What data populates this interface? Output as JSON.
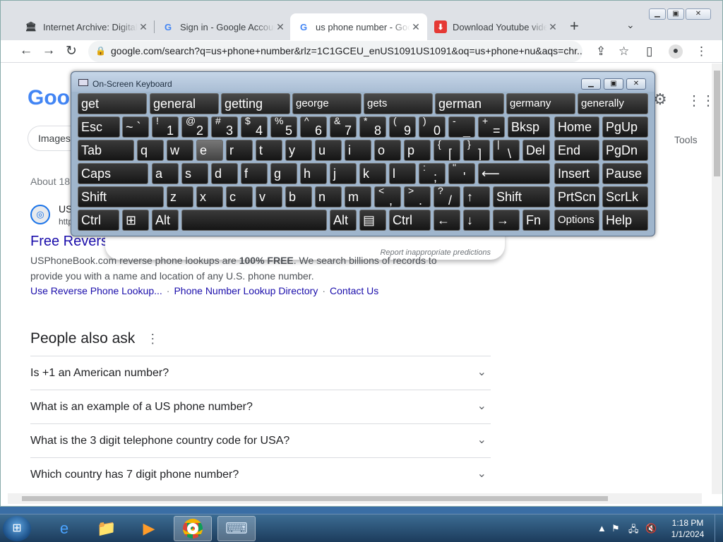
{
  "browser": {
    "tabs": [
      {
        "title": "Internet Archive: Digital",
        "icon": "museum-icon",
        "active": false
      },
      {
        "title": "Sign in - Google Accoun",
        "icon": "google-g-icon",
        "active": false
      },
      {
        "title": "us phone number - Goo",
        "icon": "google-g-icon",
        "active": true
      },
      {
        "title": "Download Youtube vide",
        "icon": "download-red-icon",
        "active": false
      }
    ],
    "new_tab": "+",
    "tab_close": "✕",
    "url": "google.com/search?q=us+phone+number&rlz=1C1GCEU_enUS1091US1091&oq=us+phone+nu&aqs=chr..."
  },
  "page": {
    "chip_images": "Images",
    "tools": "Tools",
    "about": "About 18,",
    "result": {
      "site_name": "US",
      "site_url": "http",
      "title": "Free Revers",
      "snippet_pre": "USPhoneBook.com reverse phone lookups are ",
      "snippet_bold1": "100% FREE",
      "snippet_mid": ". We search billions of records to provide you with a name and location of any U.S. phone number.",
      "links": [
        "Use Reverse Phone Lookup...",
        "Phone Number Lookup Directory",
        "Contact Us"
      ]
    },
    "report": "Report inappropriate predictions",
    "people_also_ask": "People also ask",
    "questions": [
      "Is +1 an American number?",
      "What is an example of a US phone number?",
      "What is the 3 digit telephone country code for USA?",
      "Which country has 7 digit phone number?"
    ]
  },
  "osk": {
    "title": "On-Screen Keyboard",
    "predictions": [
      "get",
      "general",
      "getting",
      "george",
      "gets",
      "german",
      "germany",
      "generally"
    ],
    "row1": {
      "esc": "Esc",
      "bksp": "Bksp",
      "home": "Home",
      "pgup": "PgUp"
    },
    "row2": {
      "tab": "Tab",
      "letters": [
        "q",
        "w",
        "e",
        "r",
        "t",
        "y",
        "u",
        "i",
        "o",
        "p"
      ],
      "del": "Del",
      "end": "End",
      "pgdn": "PgDn"
    },
    "row3": {
      "caps": "Caps",
      "letters": [
        "a",
        "s",
        "d",
        "f",
        "g",
        "h",
        "j",
        "k",
        "l"
      ],
      "insert": "Insert",
      "pause": "Pause"
    },
    "row4": {
      "shift": "Shift",
      "letters": [
        "z",
        "x",
        "c",
        "v",
        "b",
        "n",
        "m"
      ],
      "prtscn": "PrtScn",
      "scrlk": "ScrLk"
    },
    "row5": {
      "ctrl": "Ctrl",
      "alt": "Alt",
      "fn": "Fn",
      "options": "Options",
      "help": "Help"
    }
  },
  "taskbar": {
    "time": "1:18 PM",
    "date": "1/1/2024"
  }
}
